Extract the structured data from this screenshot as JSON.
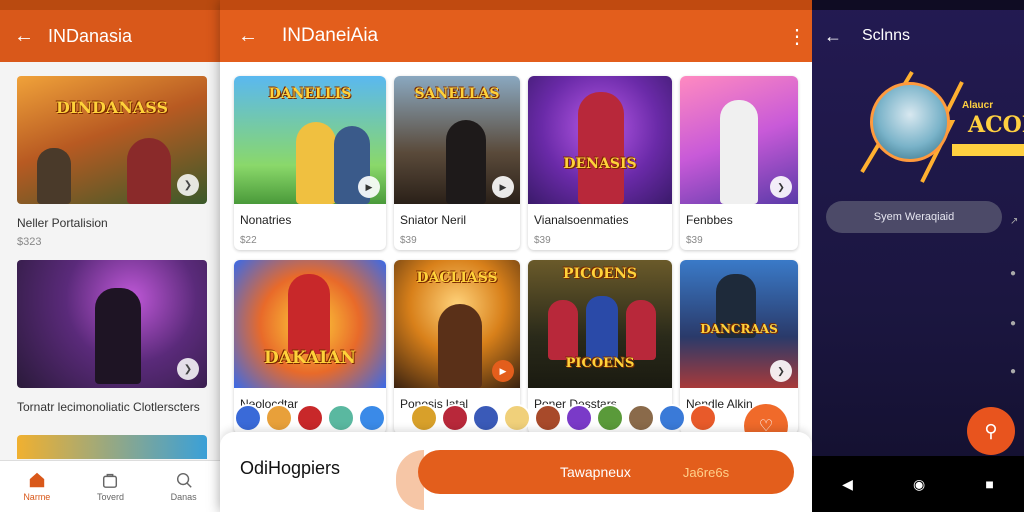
{
  "left_panel": {
    "title": "INDanasia",
    "back_icon": "arrow-left-icon",
    "cards": [
      {
        "art_title": "DINDANASS",
        "name": "Neller Portalision",
        "price": "$323"
      },
      {
        "art_title": "",
        "name": "Tornatr lecimonoliatic Clotlerscters",
        "price": ""
      }
    ],
    "nav": [
      {
        "label": "Narme",
        "icon": "home-icon",
        "active": true
      },
      {
        "label": "Toverd",
        "icon": "bag-icon",
        "active": false
      },
      {
        "label": "Danas",
        "icon": "search-icon",
        "active": false
      }
    ]
  },
  "center_panel": {
    "title": "INDaneiAia",
    "back_icon": "arrow-left-icon",
    "more_icon": "more-vertical-icon",
    "cards": [
      {
        "art_title": "DANELLIS",
        "name": "Nonatries",
        "price": "$22",
        "colors": [
          "#3aa0e8",
          "#5cc46a"
        ]
      },
      {
        "art_title": "SANELLAS",
        "name": "Sniator Neril",
        "price": "$39",
        "colors": [
          "#6a8aa8",
          "#8a6a4a"
        ]
      },
      {
        "art_title": "DENASIS",
        "name": "Vianalsoenmaties",
        "price": "$39",
        "colors": [
          "#7a3ac8",
          "#e84a8a"
        ]
      },
      {
        "art_title": "",
        "name": "Fenbbes",
        "price": "$39",
        "colors": [
          "#ff7ab0",
          "#a64ad8"
        ]
      },
      {
        "art_title": "DAKAIAN",
        "name": "Neolocdtar",
        "price": "",
        "colors": [
          "#3a7ae8",
          "#e8a03a"
        ]
      },
      {
        "art_title": "DACLIASS",
        "name": "Ponosis latal",
        "price": "",
        "colors": [
          "#7a4a1a",
          "#f0a020"
        ]
      },
      {
        "art_title": "PICOENS",
        "name": "Poner Desstars",
        "price": "",
        "colors": [
          "#2a2a1a",
          "#c89a2a"
        ]
      },
      {
        "art_title": "DANCRAAS",
        "name": "Nendle Alkin",
        "price": "",
        "colors": [
          "#2a5a9a",
          "#a83a3a"
        ]
      }
    ],
    "bottom": {
      "title": "OdiHogpiers",
      "button_label": "Tawapneux",
      "button_sub": "Ja6re6s"
    },
    "fab_icon": "chat-icon"
  },
  "right_panel": {
    "title": "Sclnns",
    "back_icon": "arrow-left-icon",
    "banner_line1": "Alaucr",
    "banner_line2": "ACOK",
    "pill_label": "Syem Weraqiaid",
    "fab_icon": "chat-bubble-icon",
    "nav": [
      "back-triangle-icon",
      "home-circle-icon",
      "recents-square-icon"
    ]
  }
}
